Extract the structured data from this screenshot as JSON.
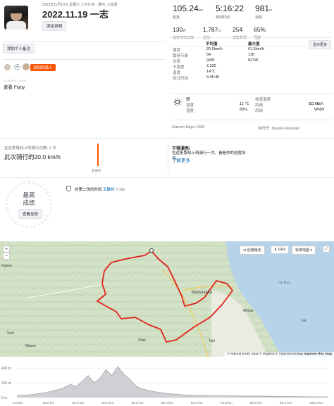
{
  "header": {
    "datetime": "2022年11月19日 星期六 上午6:48 · 濮州, 三星县",
    "title": "2022.11.19 一志",
    "add_desc": "添加说明"
  },
  "stats": [
    {
      "value": "105.24",
      "unit": "km",
      "label": "距离"
    },
    {
      "value": "5:16:22",
      "unit": "",
      "label": "移动时间"
    },
    {
      "value": "981",
      "unit": "m",
      "label": "海拔"
    },
    {
      "value": "130",
      "unit": "W",
      "label": "加权平均功率"
    },
    {
      "value": "1,787",
      "unit": "kJ",
      "label": "总功"
    },
    {
      "value": "254",
      "unit": "",
      "label": "训练负荷"
    },
    {
      "value": "65%",
      "unit": "",
      "label": "强度"
    }
  ],
  "perf_table": {
    "headers": [
      "平均值",
      "最大值"
    ],
    "rows": [
      {
        "label": "速度",
        "avg": "20.0km/h",
        "max": "61.3km/h"
      },
      {
        "label": "踏频节奏",
        "avg": "64",
        "max": "118"
      },
      {
        "label": "功率",
        "avg": "94W",
        "max": "627W"
      },
      {
        "label": "卡路里",
        "avg": "2,232",
        "max": ""
      },
      {
        "label": "温度",
        "avg": "14℃",
        "max": ""
      },
      {
        "label": "经过时间",
        "avg": "6:45:45",
        "max": ""
      }
    ],
    "show_more": "显示更多"
  },
  "add_note": "添加个人备注",
  "add_buddy": "添加同骑人",
  "flyby_caption": "STRAVA LABS",
  "flyby": "查看 Flyby",
  "weather": {
    "condition": "晴",
    "rows_left": [
      {
        "label": "温度",
        "value": "11 ℃"
      },
      {
        "label": "湿度",
        "value": "83%"
      }
    ],
    "right_title": "体感温度",
    "right_title_value": "11 ℃",
    "rows_right": [
      {
        "label": "风速",
        "value": "8.1 km/h"
      },
      {
        "label": "风向",
        "value": "WNW"
      }
    ]
  },
  "device": "Garmin Edge 1030",
  "bike": "自行车: Sworks Roubaix",
  "segment_left": {
    "line1": "在这条路线上的骑行次数: 1 次",
    "line2_prefix": "此次骑行的",
    "line2_value": "20.0 km/h"
  },
  "segment_chart_label": "此骑行",
  "segment_right": {
    "title": "干得漂亮!",
    "text": "在这条路线上再骑行一次，看看你的进度如何。",
    "link": "了解更多"
  },
  "achievement": {
    "badge_line1": "最高",
    "badge_line2": "成绩",
    "view_all": "查看全部",
    "text_prefix": "的第二快的时间",
    "segment_link": "五輪峠",
    "time": "(7:08)"
  },
  "map": {
    "create_route": "创建路线",
    "gpx": "GPX",
    "style": "标准地图",
    "zoom_in": "+",
    "zoom_out": "−",
    "attribution_left": "© Natural Earth Data",
    "attribution_mid": "© Mapbox © OpenStreetMap",
    "attribution_right": "Improve this map",
    "places": [
      "Nabari",
      "Matsusaka",
      "Tsu",
      "Ise Bay",
      "Meiwa",
      "Taki",
      "Odai",
      "Mitsue",
      "Soni",
      "Ise"
    ]
  },
  "elevation": {
    "y_ticks": [
      "400 m",
      "200 m",
      "0 m"
    ],
    "x_ticks": [
      "0.0 km",
      "10.0 km",
      "20.0 km",
      "30.0 km",
      "40.0 km",
      "50.0 km",
      "60.0 km",
      "70.0 km",
      "80.0 km",
      "90.0 km",
      "100.0 km"
    ],
    "profile": [
      [
        0,
        30
      ],
      [
        5,
        40
      ],
      [
        10,
        70
      ],
      [
        15,
        120
      ],
      [
        18,
        180
      ],
      [
        20,
        150
      ],
      [
        22,
        220
      ],
      [
        24,
        300
      ],
      [
        26,
        200
      ],
      [
        28,
        260
      ],
      [
        30,
        380
      ],
      [
        32,
        300
      ],
      [
        34,
        420
      ],
      [
        36,
        320
      ],
      [
        38,
        250
      ],
      [
        40,
        160
      ],
      [
        42,
        120
      ],
      [
        45,
        90
      ],
      [
        48,
        70
      ],
      [
        52,
        50
      ],
      [
        55,
        40
      ],
      [
        60,
        30
      ],
      [
        65,
        25
      ],
      [
        70,
        25
      ],
      [
        75,
        20
      ],
      [
        80,
        20
      ],
      [
        85,
        18
      ],
      [
        90,
        15
      ],
      [
        95,
        12
      ],
      [
        100,
        10
      ],
      [
        105,
        10
      ]
    ],
    "xlim": [
      0,
      105
    ],
    "ylim": [
      0,
      450
    ]
  },
  "colors": {
    "accent": "#fc5200",
    "route": "#e2211c",
    "link": "#0a69b5"
  }
}
